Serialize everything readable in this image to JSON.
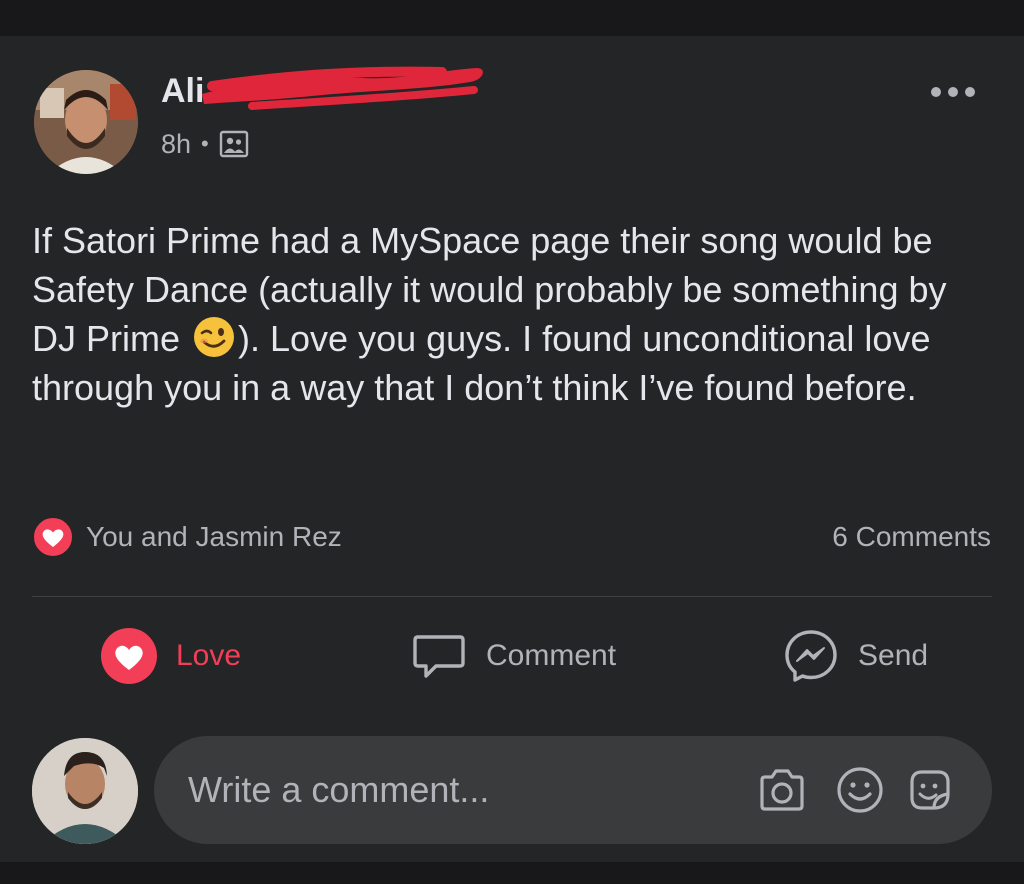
{
  "post": {
    "author_name": "Ali",
    "timestamp": "8h",
    "separator": "•",
    "audience_icon": "group-audience-icon",
    "more_icon": "more-horizontal-icon",
    "text_before_emoji": "If Satori Prime had a MySpace page their song would be Safety Dance (actually it would probably be something by DJ Prime ",
    "emoji": "winking-face-emoji",
    "text_after_emoji": "). Love you guys. I found unconditional love through you in a way that I don’t think I’ve found before."
  },
  "reactions": {
    "icon": "love-reaction-icon",
    "summary": "You and Jasmin Rez",
    "comments_count": "6 Comments"
  },
  "actions": {
    "love_label": "Love",
    "comment_label": "Comment",
    "send_label": "Send"
  },
  "composer": {
    "placeholder": "Write a comment...",
    "icons": [
      "camera-icon",
      "emoji-icon",
      "sticker-icon"
    ]
  },
  "colors": {
    "background": "#18181a",
    "card": "#242526",
    "text": "#e4e6eb",
    "secondary_text": "#b0b3b8",
    "love_accent": "#f33e58",
    "redaction": "#e0263a"
  }
}
